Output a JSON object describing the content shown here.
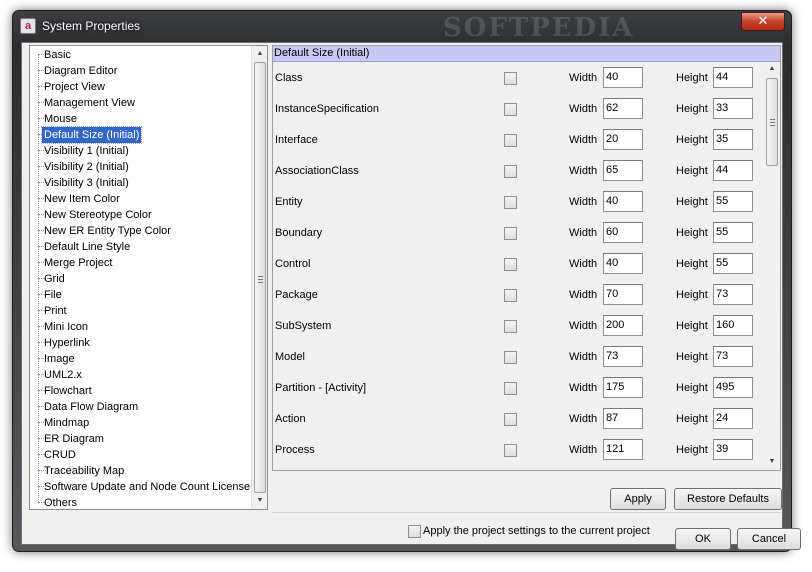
{
  "window": {
    "title": "System Properties",
    "watermark": "SOFTPEDIA",
    "app_icon": "a",
    "close_glyph": "✕"
  },
  "nav": {
    "items": [
      {
        "label": "Basic"
      },
      {
        "label": "Diagram Editor"
      },
      {
        "label": "Project View"
      },
      {
        "label": "Management View"
      },
      {
        "label": "Mouse"
      },
      {
        "label": "Default Size (Initial)",
        "selected": true
      },
      {
        "label": "Visibility 1 (Initial)"
      },
      {
        "label": "Visibility 2 (Initial)"
      },
      {
        "label": "Visibility 3 (Initial)"
      },
      {
        "label": "New Item Color"
      },
      {
        "label": "New Stereotype Color"
      },
      {
        "label": "New ER Entity Type Color"
      },
      {
        "label": "Default Line Style"
      },
      {
        "label": "Merge Project"
      },
      {
        "label": "Grid"
      },
      {
        "label": "File"
      },
      {
        "label": "Print"
      },
      {
        "label": "Mini Icon"
      },
      {
        "label": "Hyperlink"
      },
      {
        "label": "Image"
      },
      {
        "label": "UML2.x"
      },
      {
        "label": "Flowchart"
      },
      {
        "label": "Data Flow Diagram"
      },
      {
        "label": "Mindmap"
      },
      {
        "label": "ER Diagram"
      },
      {
        "label": "CRUD"
      },
      {
        "label": "Traceability Map"
      },
      {
        "label": "Software Update and Node Count License"
      },
      {
        "label": "Others"
      }
    ]
  },
  "settings": {
    "header": "Default Size (Initial)",
    "width_label": "Width",
    "height_label": "Height",
    "rows": [
      {
        "name": "Class",
        "checked": false,
        "width": "40",
        "height": "44"
      },
      {
        "name": "InstanceSpecification",
        "checked": false,
        "width": "62",
        "height": "33"
      },
      {
        "name": "Interface",
        "checked": false,
        "width": "20",
        "height": "35"
      },
      {
        "name": "AssociationClass",
        "checked": false,
        "width": "65",
        "height": "44"
      },
      {
        "name": "Entity",
        "checked": false,
        "width": "40",
        "height": "55"
      },
      {
        "name": "Boundary",
        "checked": false,
        "width": "60",
        "height": "55"
      },
      {
        "name": "Control",
        "checked": false,
        "width": "40",
        "height": "55"
      },
      {
        "name": "Package",
        "checked": false,
        "width": "70",
        "height": "73"
      },
      {
        "name": "SubSystem",
        "checked": false,
        "width": "200",
        "height": "160"
      },
      {
        "name": "Model",
        "checked": false,
        "width": "73",
        "height": "73"
      },
      {
        "name": "Partition - [Activity]",
        "checked": false,
        "width": "175",
        "height": "495"
      },
      {
        "name": "Action",
        "checked": false,
        "width": "87",
        "height": "24"
      },
      {
        "name": "Process",
        "checked": false,
        "width": "121",
        "height": "39"
      }
    ],
    "apply_label": "Apply",
    "restore_label": "Restore Defaults"
  },
  "footer": {
    "apply_project_label": "Apply the project settings to the current project",
    "apply_project_checked": false,
    "ok_label": "OK",
    "cancel_label": "Cancel"
  },
  "scrollbar": {
    "up_glyph": "▲",
    "down_glyph": "▼"
  }
}
